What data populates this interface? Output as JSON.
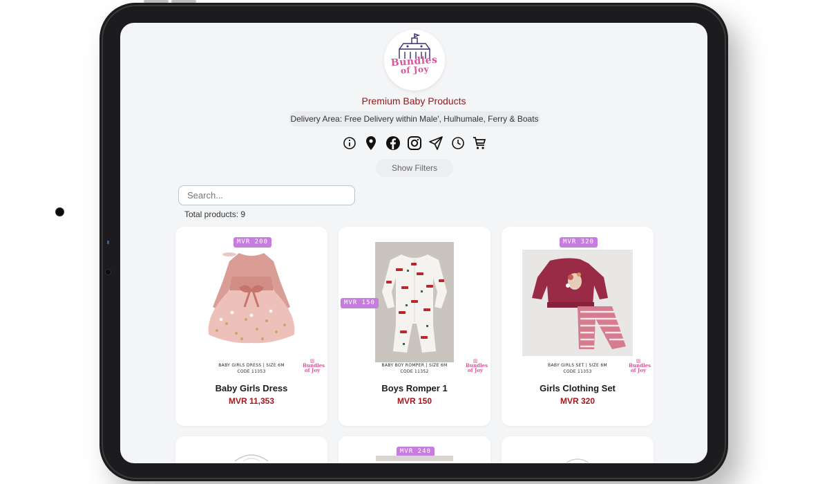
{
  "brand": {
    "logo_text": "Bundles of Joy",
    "tagline": "Premium Baby Products",
    "delivery": "Delivery Area: Free Delivery within Male', Hulhumale, Ferry & Boats"
  },
  "icons": [
    {
      "name": "info-icon"
    },
    {
      "name": "location-pin-icon"
    },
    {
      "name": "facebook-icon"
    },
    {
      "name": "instagram-icon"
    },
    {
      "name": "send-icon"
    },
    {
      "name": "clock-icon"
    },
    {
      "name": "cart-icon"
    }
  ],
  "filters": {
    "show_label": "Show Filters"
  },
  "search": {
    "placeholder": "Search..."
  },
  "total_label": "Total products: 9",
  "products": [
    {
      "name": "Baby Girls Dress",
      "price": "MVR 11,353",
      "tag": "MVR 200",
      "caption_line1": "BABY GIRLS DRESS | SIZE 6M",
      "caption_line2": "CODE 11353"
    },
    {
      "name": "Boys Romper 1",
      "price": "MVR 150",
      "tag": "MVR 150",
      "caption_line1": "BABY BOY ROMPER | SIZE 6M",
      "caption_line2": "CODE 11352"
    },
    {
      "name": "Girls Clothing Set",
      "price": "MVR 320",
      "tag": "MVR 320",
      "caption_line1": "BABY GIRLS SET | SIZE 6M",
      "caption_line2": "CODE 11353"
    },
    {
      "tag": ""
    },
    {
      "tag": "MVR 240"
    },
    {
      "tag": ""
    }
  ],
  "colors": {
    "accent": "#a3161a",
    "tagline": "#8b1a1a",
    "tag_bg": "#c77de0",
    "logo_pink": "#d9559a"
  }
}
